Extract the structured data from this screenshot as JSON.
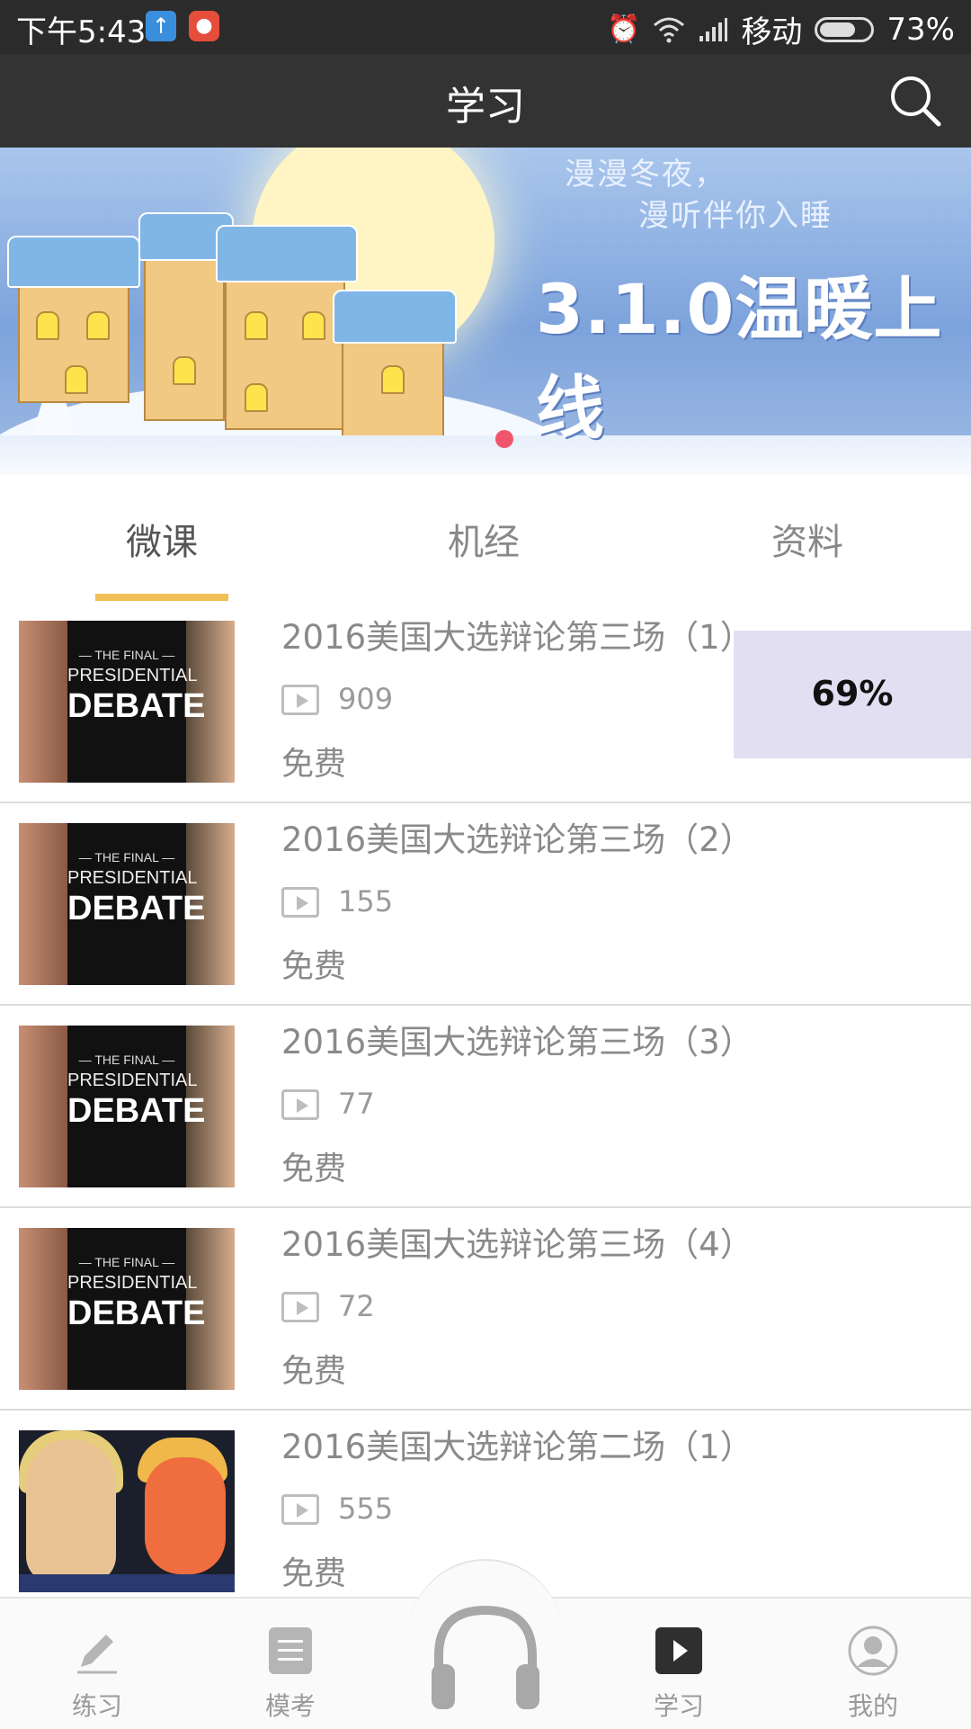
{
  "status_bar": {
    "time": "下午5:43",
    "carrier": "移动",
    "battery": "73%",
    "battery_level": 0.73
  },
  "header": {
    "title": "学习",
    "search_icon": "search-icon"
  },
  "banner": {
    "line1": "漫漫冬夜，",
    "line2": "漫听伴你入睡",
    "headline": "3.1.0温暖上线"
  },
  "tabs": [
    {
      "label": "微课",
      "active": true
    },
    {
      "label": "机经",
      "active": false
    },
    {
      "label": "资料",
      "active": false
    }
  ],
  "thumb_text": {
    "line1": "— THE FINAL —",
    "line2": "PRESIDENTIAL",
    "line3": "DEBATE"
  },
  "courses": [
    {
      "title": "2016美国大选辩论第三场（1）",
      "plays": "909",
      "price": "免费"
    },
    {
      "title": "2016美国大选辩论第三场（2）",
      "plays": "155",
      "price": "免费"
    },
    {
      "title": "2016美国大选辩论第三场（3）",
      "plays": "77",
      "price": "免费"
    },
    {
      "title": "2016美国大选辩论第三场（4）",
      "plays": "72",
      "price": "免费"
    },
    {
      "title": "2016美国大选辩论第二场（1）",
      "plays": "555",
      "price": "免费"
    }
  ],
  "progress_overlay": {
    "text": "69%",
    "value": 0.69
  },
  "bottom_nav": [
    {
      "label": "练习",
      "icon": "pencil-icon",
      "active": false
    },
    {
      "label": "模考",
      "icon": "document-icon",
      "active": false
    },
    {
      "label": "",
      "icon": "headphones-icon",
      "active": false
    },
    {
      "label": "学习",
      "icon": "play-icon",
      "active": true
    },
    {
      "label": "我的",
      "icon": "profile-icon",
      "active": false
    }
  ],
  "colors": {
    "header_bg": "#333333",
    "tab_indicator": "#f0bf55",
    "banner_dot": "#f0566b"
  }
}
